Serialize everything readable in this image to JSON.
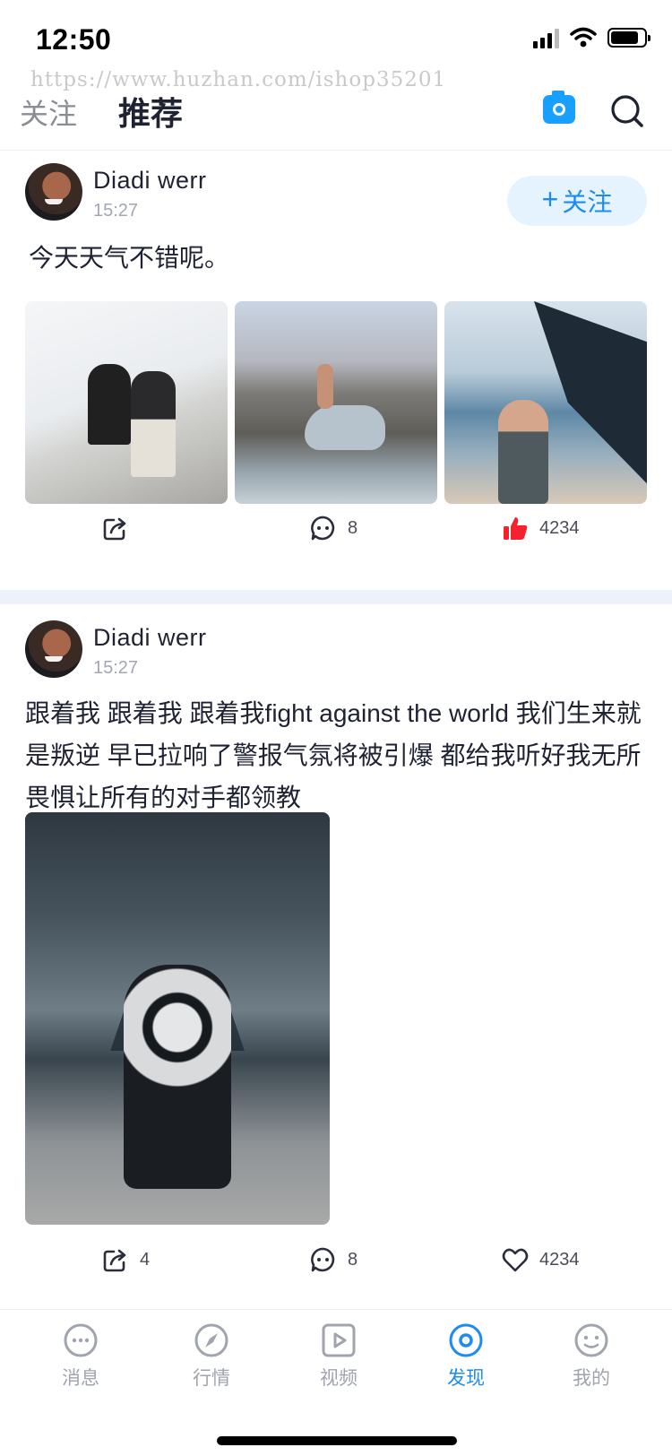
{
  "status": {
    "time": "12:50"
  },
  "watermark": "https://www.huzhan.com/ishop35201",
  "top_nav": {
    "tab_follow": "关注",
    "tab_recommend": "推荐"
  },
  "posts": [
    {
      "user": "Diadi werr",
      "time": "15:27",
      "follow_label": "关注",
      "text": "今天天气不错呢。",
      "share_count": "",
      "comment_count": "8",
      "like_count": "4234",
      "liked": true
    },
    {
      "user": "Diadi werr",
      "time": "15:27",
      "text": "跟着我 跟着我 跟着我fight against the world  我们生来就是叛逆 早已拉响了警报气氛将被引爆 都给我听好我无所畏惧让所有的对手都领教",
      "share_count": "4",
      "comment_count": "8",
      "like_count": "4234",
      "liked": false
    }
  ],
  "tabs": [
    {
      "label": "消息",
      "icon": "message-icon",
      "active": false
    },
    {
      "label": "行情",
      "icon": "compass-icon",
      "active": false
    },
    {
      "label": "视频",
      "icon": "video-icon",
      "active": false
    },
    {
      "label": "发现",
      "icon": "discover-icon",
      "active": true
    },
    {
      "label": "我的",
      "icon": "profile-icon",
      "active": false
    }
  ],
  "colors": {
    "accent": "#1c8bf2",
    "like_red": "#f5222d",
    "divider": "#edf2fa"
  }
}
